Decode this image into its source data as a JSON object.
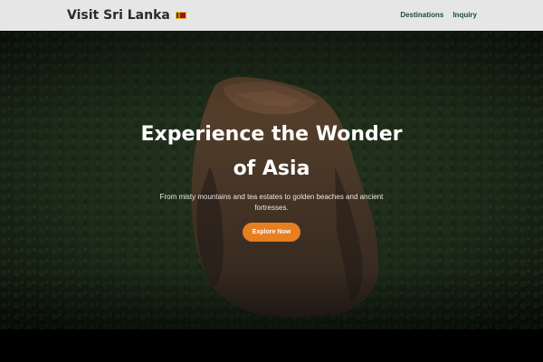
{
  "header": {
    "brand": "Visit Sri Lanka",
    "flag_icon": "sri-lanka-flag-icon",
    "nav": [
      {
        "label": "Destinations"
      },
      {
        "label": "Inquiry"
      }
    ]
  },
  "hero": {
    "title": "Experience the Wonder of Asia",
    "subtitle": "From misty mountains and tea estates to golden beaches and ancient fortresses.",
    "cta_label": "Explore Now"
  },
  "colors": {
    "nav_background": "#e6e6e6",
    "nav_link": "#1e4b2f",
    "cta": "#e67e22",
    "flag_maroon": "#8d153a",
    "flag_gold": "#f6b416"
  }
}
